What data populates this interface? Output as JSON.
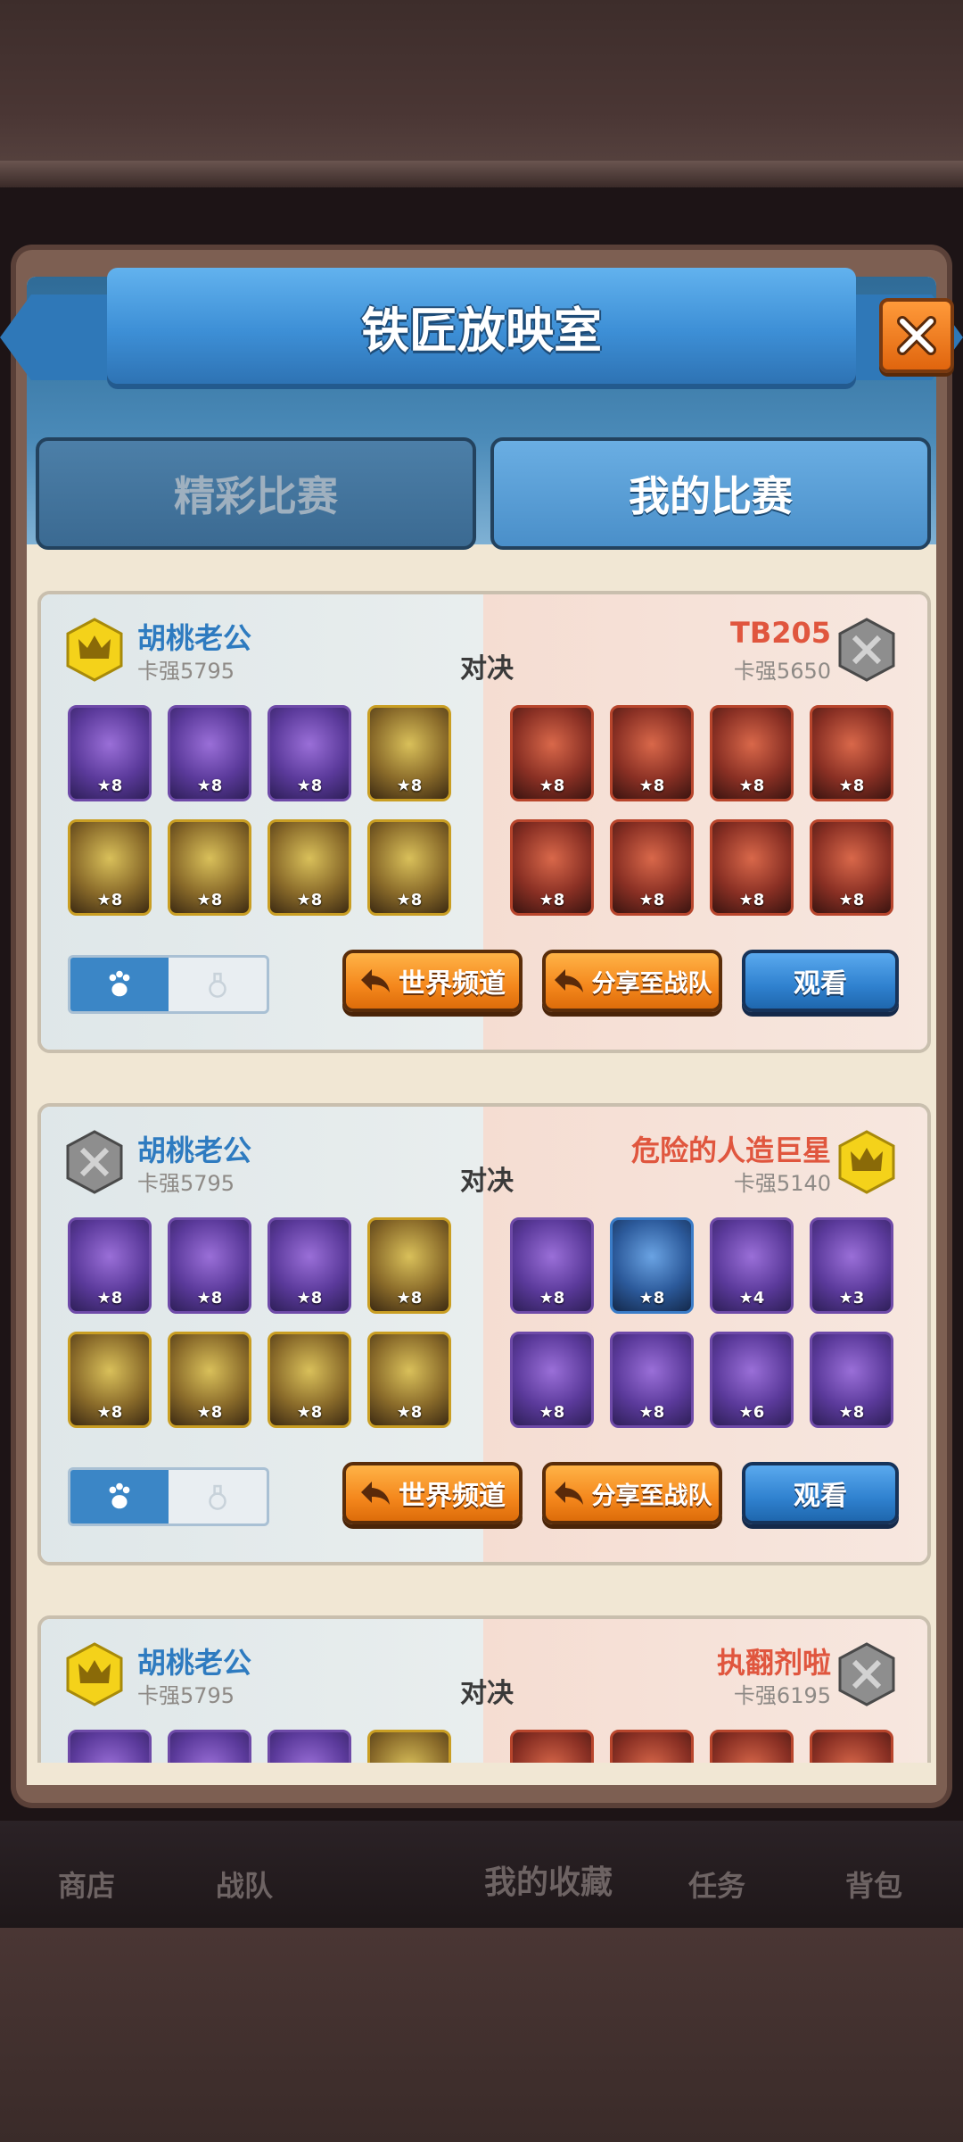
{
  "modal": {
    "title": "铁匠放映室",
    "tabs": [
      {
        "label": "精彩比赛",
        "active": false
      },
      {
        "label": "我的比赛",
        "active": true
      }
    ]
  },
  "vs_label": "对决",
  "buttons": {
    "world_channel": "世界频道",
    "share_team": "分享至战队",
    "watch": "观看"
  },
  "matches": [
    {
      "left": {
        "name": "胡桃老公",
        "score": "卡强5795",
        "badge": "gold-crown"
      },
      "right": {
        "name": "TB205",
        "score": "卡强5650",
        "badge": "silver-badge"
      },
      "left_units": [
        "★8",
        "★8",
        "★8",
        "★8",
        "★8",
        "★8",
        "★8",
        "★8"
      ],
      "right_units": [
        "★8",
        "★8",
        "★8",
        "★8",
        "★8",
        "★8",
        "★8",
        "★8"
      ]
    },
    {
      "left": {
        "name": "胡桃老公",
        "score": "卡强5795",
        "badge": "silver-badge"
      },
      "right": {
        "name": "危险的人造巨星",
        "score": "卡强5140",
        "badge": "gold-crown"
      },
      "left_units": [
        "★8",
        "★8",
        "★8",
        "★8",
        "★8",
        "★8",
        "★8",
        "★8"
      ],
      "right_units": [
        "★8",
        "★8",
        "★4",
        "★3",
        "★8",
        "★8",
        "★6",
        "★8"
      ]
    },
    {
      "left": {
        "name": "胡桃老公",
        "score": "卡强5795",
        "badge": "gold-crown"
      },
      "right": {
        "name": "执翻剂啦",
        "score": "卡强6195",
        "badge": "silver-badge"
      }
    }
  ],
  "bottom_nav": [
    "商店",
    "战队",
    "我的收藏",
    "任务",
    "背包"
  ],
  "colors": {
    "accent_blue": "#3d8fd6",
    "orange_button": "#f4871c",
    "player_left": "#2e7bc0",
    "player_right": "#e0563e"
  }
}
